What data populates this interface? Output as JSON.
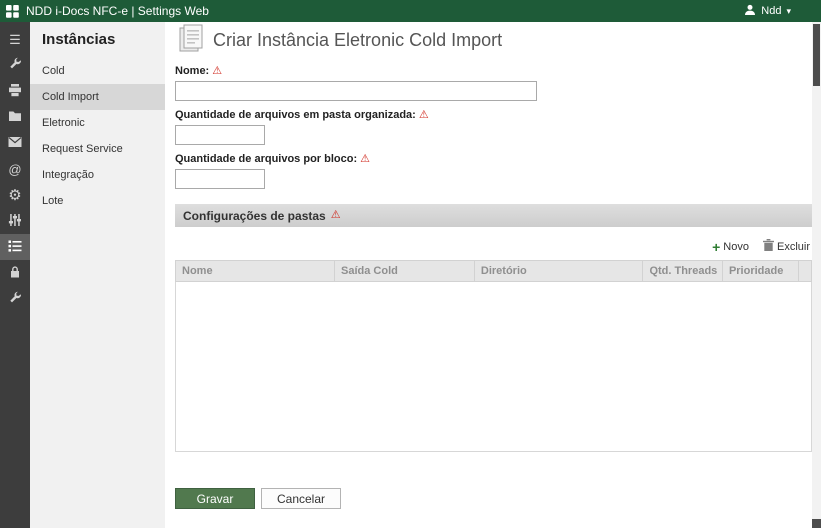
{
  "topbar": {
    "title": "NDD i-Docs NFC-e | Settings Web",
    "user_name": "Ndd"
  },
  "icons": {
    "warning": "⚠",
    "menu": "☰",
    "at": "@",
    "gear": "⚙",
    "plus": "+",
    "chevron_down": "▾"
  },
  "sidebar": {
    "title": "Instâncias",
    "items": [
      {
        "label": "Cold"
      },
      {
        "label": "Cold Import",
        "selected": true
      },
      {
        "label": "Eletronic"
      },
      {
        "label": "Request Service"
      },
      {
        "label": "Integração"
      },
      {
        "label": "Lote"
      }
    ]
  },
  "main": {
    "title": "Criar Instância Eletronic Cold Import",
    "fields": {
      "nome_label": "Nome:",
      "qtd_pasta_label": "Quantidade de arquivos em pasta organizada:",
      "qtd_bloco_label": "Quantidade de arquivos por bloco:"
    },
    "section_title": "Configurações de pastas",
    "toolbar": {
      "new_label": "Novo",
      "delete_label": "Excluir"
    },
    "table": {
      "headers": [
        "Nome",
        "Saída Cold",
        "Diretório",
        "Qtd. Threads",
        "Prioridade"
      ]
    },
    "buttons": {
      "save": "Gravar",
      "cancel": "Cancelar"
    }
  },
  "colors": {
    "topbar_green": "#1e5b38",
    "save_button_green": "#51794e",
    "warning_red": "#d02b20"
  }
}
